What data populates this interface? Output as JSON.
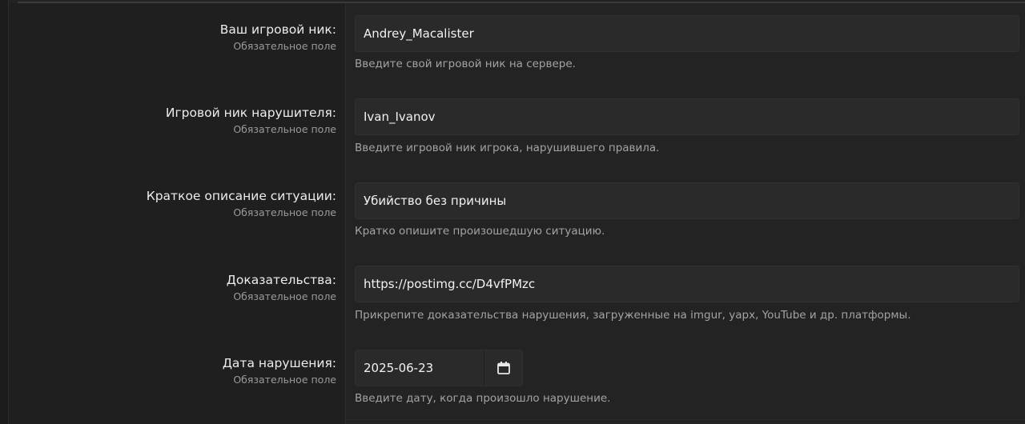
{
  "form": {
    "fields": [
      {
        "label": "Ваш игровой ник:",
        "required": "Обязательное поле",
        "value": "Andrey_Macalister",
        "hint": "Введите свой игровой ник на сервере."
      },
      {
        "label": "Игровой ник нарушителя:",
        "required": "Обязательное поле",
        "value": "Ivan_Ivanov",
        "hint": "Введите игровой ник игрока, нарушившего правила."
      },
      {
        "label": "Краткое описание ситуации:",
        "required": "Обязательное поле",
        "value": "Убийство без причины",
        "hint": "Кратко опишите произошедшую ситуацию."
      },
      {
        "label": "Доказательства:",
        "required": "Обязательное поле",
        "value": "https://postimg.cc/D4vfPMzc",
        "hint": "Прикрепите доказательства нарушения, загруженные на imgur, yapx, YouTube и др. платформы."
      },
      {
        "label": "Дата нарушения:",
        "required": "Обязательное поле",
        "value": "2025-06-23",
        "hint": "Введите дату, когда произошло нарушение.",
        "icon": "calendar-icon"
      }
    ]
  }
}
